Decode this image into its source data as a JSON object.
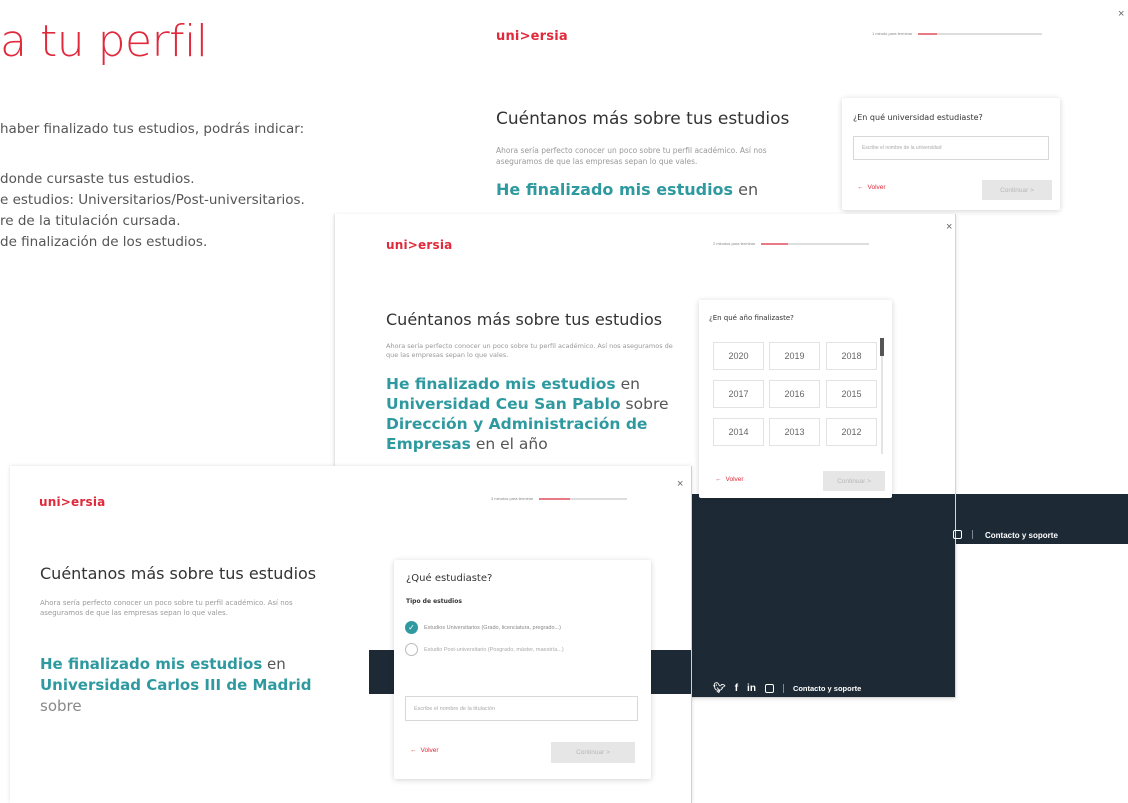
{
  "background": {
    "title": "a tu perfil",
    "intro": "haber finalizado tus estudios, podrás indicar:",
    "items": [
      "donde cursaste tus estudios.",
      "e estudios: Universitarios/Post-universitarios.",
      "re de la titulación cursada.",
      "de finalización de los estudios."
    ]
  },
  "windows": {
    "university": {
      "logo": "uni>ersia",
      "close": "×",
      "progress_text": "1 minuto para terminar",
      "progress": 0.15,
      "heading": "Cuéntanos más sobre tus estudios",
      "description": "Ahora sería perfecto conocer un poco sobre tu perfil académico. Así nos aseguramos de que las empresas sepan lo que vales.",
      "summary_highlight": "He finalizado mis estudios",
      "summary_rest": " en",
      "question": "¿En qué universidad estudiaste?",
      "input_placeholder": "Escribe el nombre de la universidad",
      "back": "Volver",
      "continue": "Continuar >"
    },
    "year": {
      "logo": "uni>ersia",
      "close": "×",
      "progress_text": "2 minutos para terminar",
      "progress": 0.25,
      "heading": "Cuéntanos más sobre tus estudios",
      "description": "Ahora sería perfecto conocer un poco sobre tu perfil académico. Así nos aseguramos de que las empresas sepan lo que vales.",
      "summary": {
        "s1": "He finalizado mis estudios",
        "t1": " en",
        "s2": "Universidad Ceu San Pablo",
        "t2": " sobre",
        "s3": "Dirección y Administración de Empresas",
        "t3": " en el año"
      },
      "question": "¿En qué año finalizaste?",
      "years": [
        "2020",
        "2019",
        "2018",
        "2017",
        "2016",
        "2015",
        "2014",
        "2013",
        "2012"
      ],
      "back": "Volver",
      "continue": "Continuar >",
      "footer_link": "Contacto y soporte"
    },
    "study": {
      "logo": "uni>ersia",
      "close": "×",
      "progress_text": "3 minutos para terminar",
      "progress": 0.35,
      "heading": "Cuéntanos más sobre tus estudios",
      "description": "Ahora sería perfecto conocer un poco sobre tu perfil académico. Así nos aseguramos de que las empresas sepan lo que vales.",
      "summary": {
        "s1": "He finalizado mis estudios",
        "t1": " en",
        "s2": "Universidad Carlos III de Madrid",
        "t3": "sobre"
      },
      "question": "¿Qué estudiaste?",
      "subtitle": "Tipo de estudios",
      "options": [
        {
          "label": "Estudios Universitarios (Grado, licenciatura, pregrado...)",
          "selected": true
        },
        {
          "label": "Estudio Post-universitario (Posgrado, máster, maestría...)",
          "selected": false
        }
      ],
      "input_placeholder": "Escribe el nombre de la titulación",
      "back": "Volver",
      "continue": "Continuar >",
      "footer_link": "Contacto y soporte",
      "social_icons": [
        "twitter-icon",
        "facebook-icon",
        "linkedin-icon",
        "instagram-icon"
      ]
    }
  },
  "colors": {
    "brand_red": "#e02a3c",
    "teal": "#2e9aa0",
    "footer": "#1d2a36",
    "progress": "#e87a86"
  }
}
